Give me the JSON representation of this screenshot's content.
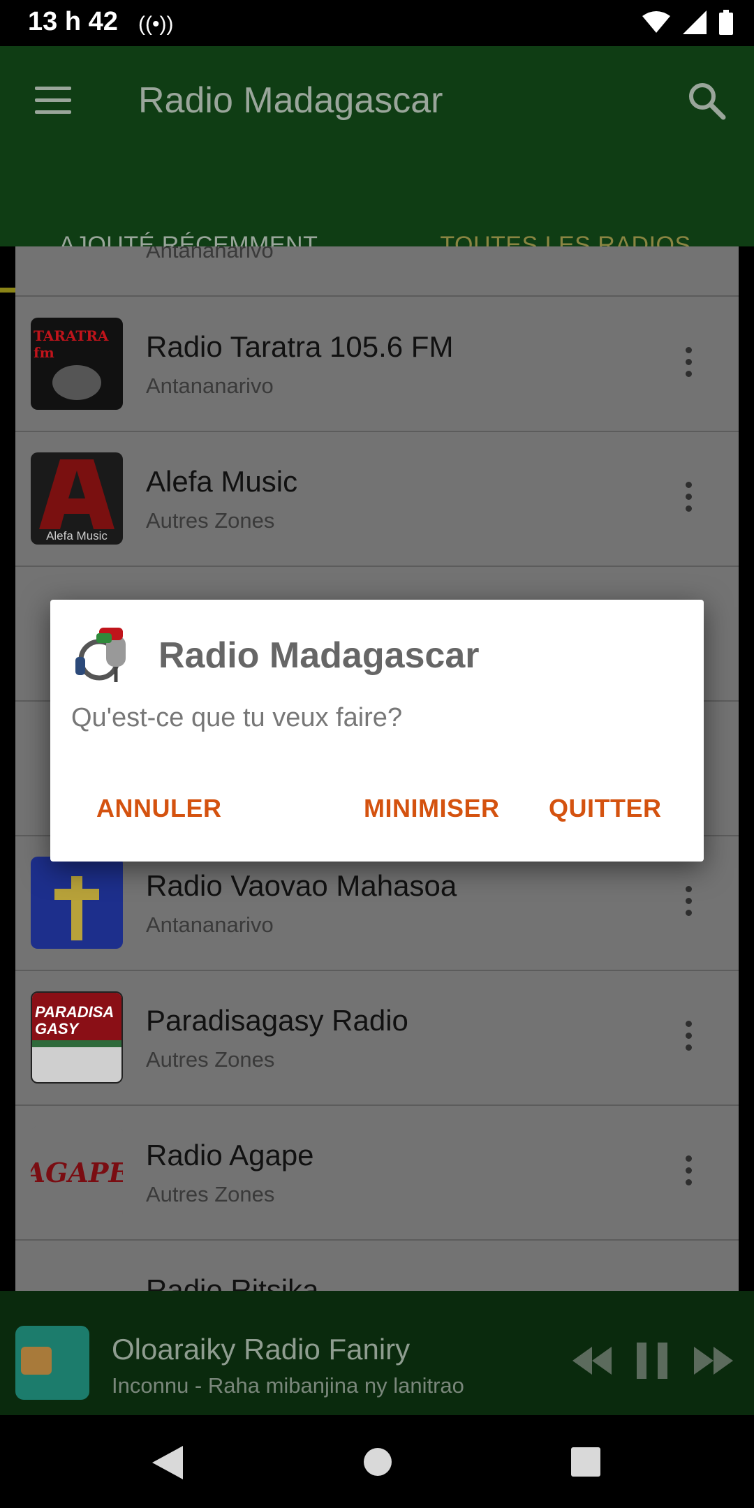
{
  "status_bar": {
    "time": "13 h 42"
  },
  "app_bar": {
    "title": "Radio Madagascar"
  },
  "tabs": [
    {
      "label": "AJOUTÉ RÉCEMMENT"
    },
    {
      "label": "TOUTES LES RADIOS"
    }
  ],
  "list": {
    "partial_top_sub": "Antananarivo",
    "items": [
      {
        "name": "Radio Taratra 105.6 FM",
        "location": "Antananarivo",
        "logo_text": "TARATRA fm"
      },
      {
        "name": "Alefa Music",
        "location": "Autres Zones",
        "logo_text": "Alefa Music"
      },
      {
        "name": "Radio Vaovao Mahasoa",
        "location": "Antananarivo"
      },
      {
        "name": "Paradisagasy Radio",
        "location": "Autres Zones",
        "logo_text": "PARADISA GASY"
      },
      {
        "name": "Radio Agape",
        "location": "Autres Zones",
        "logo_text": "AGAPE"
      }
    ],
    "partial_bottom_name": "Radio Ritsika"
  },
  "dialog": {
    "title": "Radio Madagascar",
    "message": "Qu'est-ce que tu veux faire?",
    "buttons": {
      "cancel": "ANNULER",
      "minimize": "MINIMISER",
      "quit": "QUITTER"
    }
  },
  "player": {
    "station": "Oloaraiky Radio Faniry",
    "track": "Inconnu - Raha mibanjina ny lanitrao"
  },
  "colors": {
    "appbar": "#0f3d14",
    "accent": "#d4520f",
    "tab_indicator": "#8a8417"
  }
}
